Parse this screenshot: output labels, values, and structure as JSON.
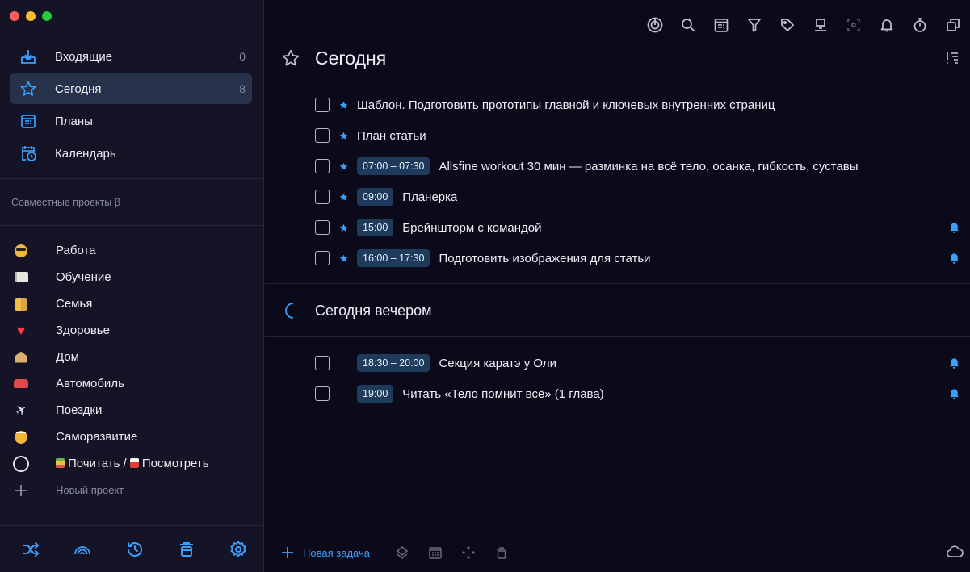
{
  "sidebar": {
    "nav": [
      {
        "label": "Входящие",
        "count": "0",
        "icon": "inbox-icon"
      },
      {
        "label": "Сегодня",
        "count": "8",
        "icon": "star-icon"
      },
      {
        "label": "Планы",
        "count": "",
        "icon": "calendar-grid-icon"
      },
      {
        "label": "Календарь",
        "count": "",
        "icon": "calendar-clock-icon"
      }
    ],
    "section_label": "Совместные проекты β",
    "projects": [
      {
        "label": "Работа",
        "icon": "sunglasses-emoji-icon"
      },
      {
        "label": "Обучение",
        "icon": "book-emoji-icon"
      },
      {
        "label": "Семья",
        "icon": "family-emoji-icon"
      },
      {
        "label": "Здоровье",
        "icon": "heart-emoji-icon"
      },
      {
        "label": "Дом",
        "icon": "house-emoji-icon"
      },
      {
        "label": "Автомобиль",
        "icon": "car-emoji-icon"
      },
      {
        "label": "Поездки",
        "icon": "plane-emoji-icon"
      },
      {
        "label": "Саморазвитие",
        "icon": "angel-emoji-icon"
      },
      {
        "label_a": "Почитать / ",
        "label_b": "Посмотреть",
        "icon": "ring-icon"
      }
    ],
    "new_project": "Новый проект",
    "bottom_icons": [
      "shuffle-icon",
      "rainbow-icon",
      "history-icon",
      "trash-icon",
      "settings-icon"
    ]
  },
  "main": {
    "toolbar_icons": [
      "focus-icon",
      "search-icon",
      "calendar-icon",
      "filter-icon",
      "tag-icon",
      "move-icon",
      "scan-icon",
      "bell-icon",
      "timer-icon",
      "copy-icon"
    ],
    "today_title": "Сегодня",
    "today_tasks": [
      {
        "time": "",
        "text": "Шаблон. Подготовить прототипы главной и ключевых внутренних страниц",
        "bell": false
      },
      {
        "time": "",
        "text": "План статьи",
        "bell": false
      },
      {
        "time": "07:00 – 07:30",
        "text": "Allsfine workout 30 мин — разминка на всё тело, осанка, гибкость, суставы",
        "bell": false
      },
      {
        "time": "09:00",
        "text": "Планерка",
        "bell": false
      },
      {
        "time": "15:00",
        "text": "Брейншторм с командой",
        "bell": true
      },
      {
        "time": "16:00 – 17:30",
        "text": "Подготовить изображения для статьи",
        "bell": true
      }
    ],
    "evening_title": "Сегодня вечером",
    "evening_tasks": [
      {
        "time": "18:30 – 20:00",
        "text": "Секция каратэ у Оли",
        "bell": true
      },
      {
        "time": "19:00",
        "text": "Читать «Тело помнит всё» (1 глава)",
        "bell": true
      }
    ],
    "new_task": "Новая задача",
    "accent": "#3aa0ff"
  }
}
